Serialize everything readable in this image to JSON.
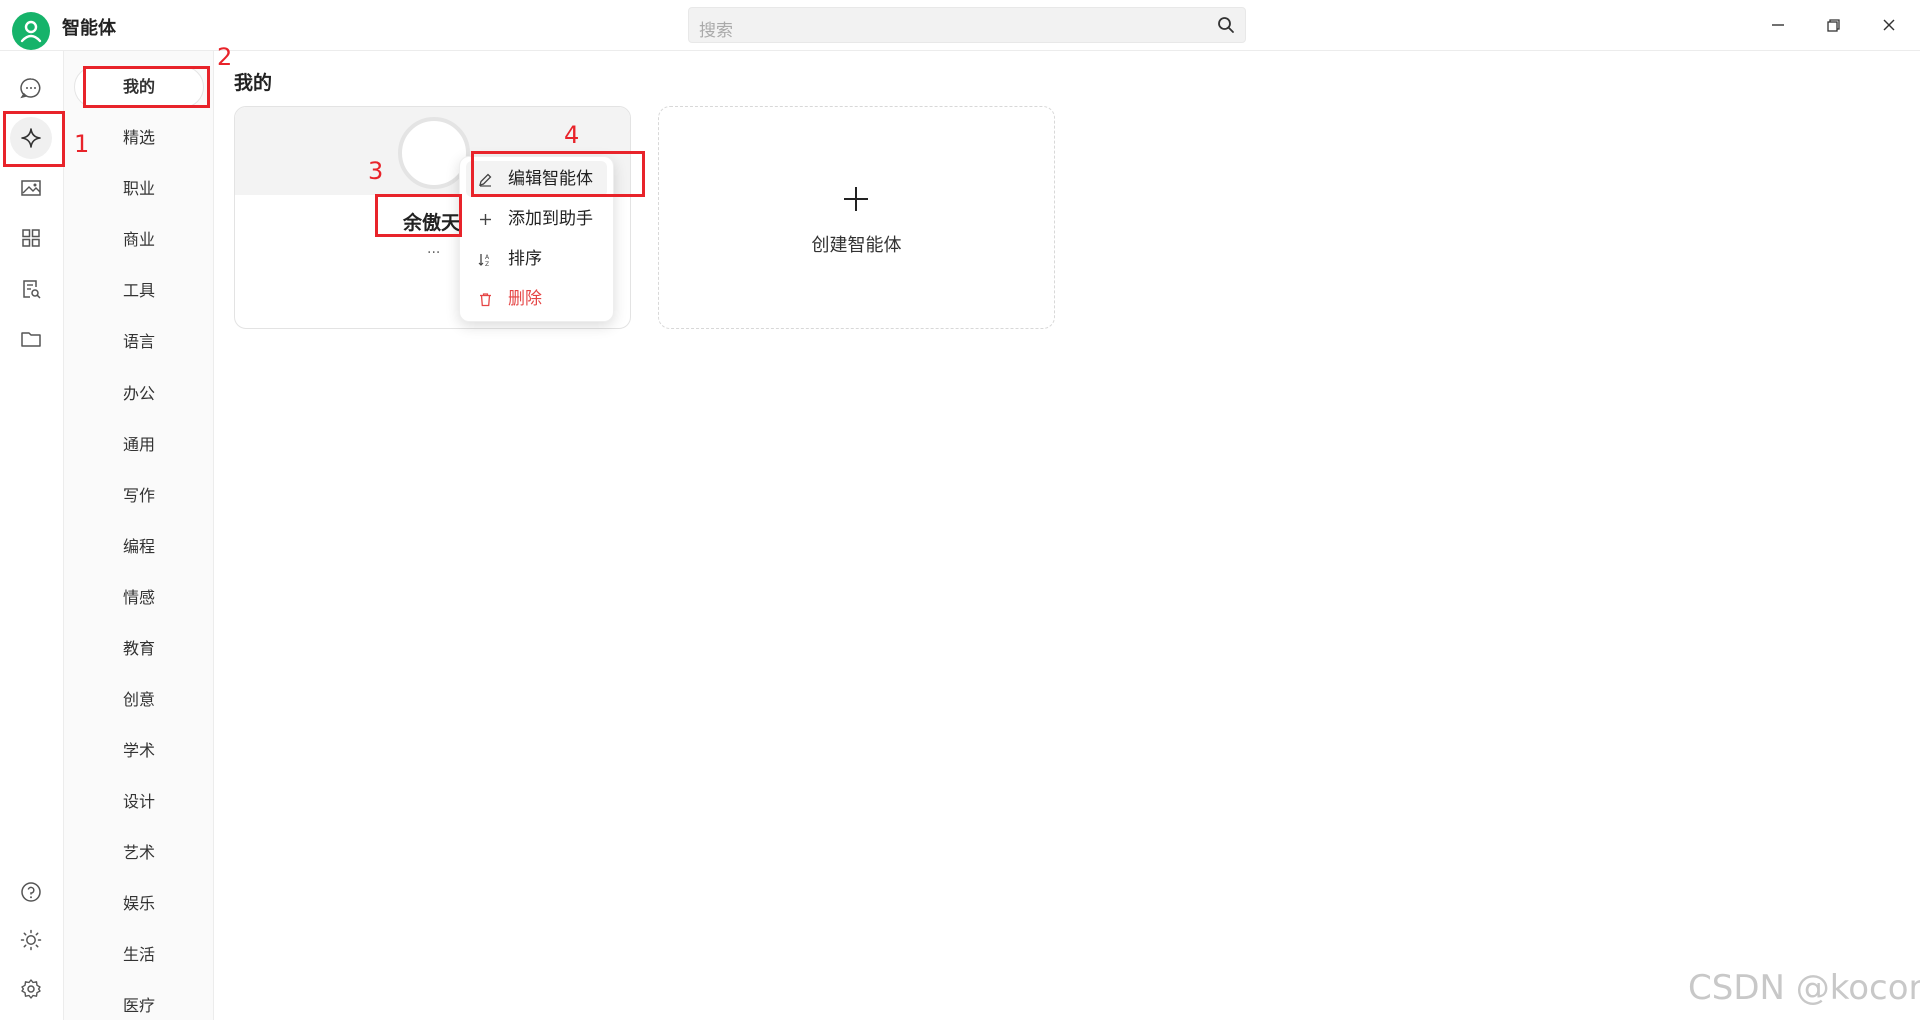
{
  "app": {
    "title": "智能体"
  },
  "search": {
    "placeholder": "搜索"
  },
  "rail": {
    "items": [
      "chat",
      "agents",
      "images",
      "apps",
      "docs",
      "files"
    ],
    "bottom": [
      "help",
      "theme",
      "settings"
    ]
  },
  "categories": [
    "我的",
    "精选",
    "职业",
    "商业",
    "工具",
    "语言",
    "办公",
    "通用",
    "写作",
    "编程",
    "情感",
    "教育",
    "创意",
    "学术",
    "设计",
    "艺术",
    "娱乐",
    "生活",
    "医疗"
  ],
  "main": {
    "section_title": "我的",
    "card": {
      "name": "余傲天",
      "desc": "..."
    },
    "create_label": "创建智能体"
  },
  "menu": {
    "edit": "编辑智能体",
    "add": "添加到助手",
    "sort": "排序",
    "delete": "删除"
  },
  "annotations": [
    "1",
    "2",
    "3",
    "4"
  ],
  "watermark": "CSDN @kocor",
  "colors": {
    "accent": "#16b36a",
    "annotation": "#e8232a",
    "danger": "#e54545"
  }
}
